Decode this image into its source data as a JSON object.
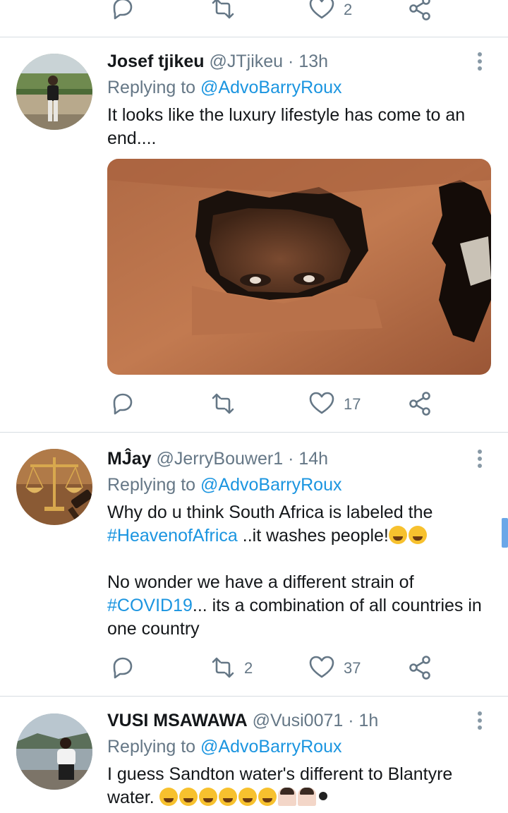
{
  "colors": {
    "link": "#1b95e0",
    "secondary_text": "#657786",
    "primary_text": "#14171a",
    "divider": "#d7dde2",
    "icon": "#657786"
  },
  "top_actions": {
    "reply_icon": "reply-icon",
    "retweet_icon": "retweet-icon",
    "like_icon": "heart-icon",
    "like_count": "2",
    "share_icon": "share-icon"
  },
  "tweets": [
    {
      "name": "Josef tjikeu",
      "handle": "@JTjikeu",
      "dot": "·",
      "time": "13h",
      "replying_prefix": "Replying to ",
      "replying_to": "@AdvoBarryRoux",
      "text_line1": "It looks like the luxury lifestyle has come to an",
      "text_line2": "end....",
      "retweet_count": "",
      "like_count": "17"
    },
    {
      "name": "MĴay",
      "handle": "@JerryBouwer1",
      "dot": "·",
      "time": "14h",
      "replying_prefix": "Replying to ",
      "replying_to": "@AdvoBarryRoux",
      "text_p1_a": "Why do u think South Africa is labeled the",
      "text_p1_hashtag": "#HeavenofAfrica",
      "text_p1_b": " ..it washes people!",
      "text_p2_a": "No wonder we have a different strain of",
      "text_p2_hashtag": "#COVID19",
      "text_p2_b": "... its a combination of all countries in",
      "text_p2_c": "one country",
      "retweet_count": "2",
      "like_count": "37"
    },
    {
      "name": "VUSI MSAWAWA",
      "handle": "@Vusi0071",
      "dot": "·",
      "time": "1h",
      "replying_prefix": "Replying to ",
      "replying_to": "@AdvoBarryRoux",
      "text_line1": "I guess Sandton water's different to Blantyre",
      "text_line2": "water."
    }
  ]
}
